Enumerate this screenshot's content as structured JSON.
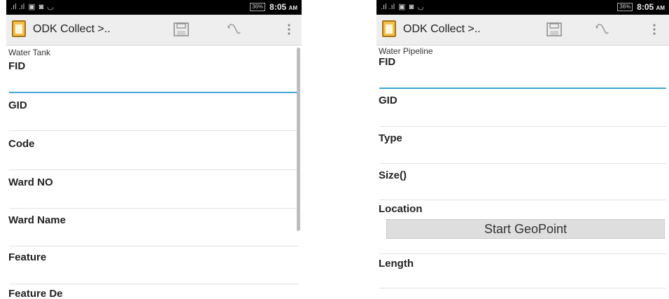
{
  "left": {
    "status": {
      "time": "8:05",
      "ampm": "AM",
      "battery": "36%"
    },
    "title": "ODK Collect >..",
    "form_name": "Water Tank",
    "fields": [
      "FID",
      "GID",
      "Code",
      "Ward NO",
      "Ward Name",
      "Feature",
      "Feature De"
    ]
  },
  "right": {
    "status": {
      "time": "8:05",
      "ampm": "AM",
      "battery": "36%"
    },
    "title": "ODK Collect >..",
    "form_name": "Water Pipeline",
    "fields": [
      "FID",
      "GID",
      "Type",
      "Size()",
      "Location",
      "Length"
    ],
    "geo_button": "Start GeoPoint"
  },
  "colors": {
    "active_line": "#3fa6d6",
    "status_bar": "#000000",
    "action_bar": "#eeeeee"
  },
  "icons": [
    "signal-icon",
    "image-icon",
    "camera-icon",
    "wifi-icon",
    "save-icon",
    "jump-icon",
    "overflow-menu-icon"
  ]
}
